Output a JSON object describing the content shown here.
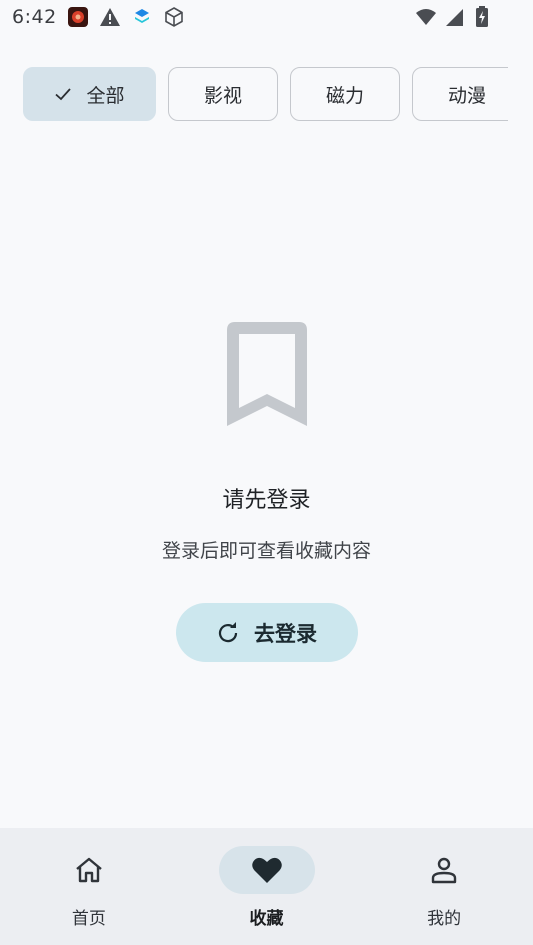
{
  "status_bar": {
    "time": "6:42",
    "left_icons": [
      "app-icon",
      "warning-icon",
      "layers-icon",
      "cube-icon"
    ],
    "right_icons": [
      "wifi-icon",
      "signal-icon",
      "battery-icon"
    ]
  },
  "filters": {
    "chips": [
      {
        "label": "全部",
        "selected": true
      },
      {
        "label": "影视",
        "selected": false
      },
      {
        "label": "磁力",
        "selected": false
      },
      {
        "label": "动漫",
        "selected": false
      }
    ]
  },
  "empty_state": {
    "icon": "bookmark-icon",
    "title": "请先登录",
    "description": "登录后即可查看收藏内容",
    "button_label": "去登录"
  },
  "bottom_nav": {
    "items": [
      {
        "label": "首页",
        "icon": "home-icon",
        "active": false
      },
      {
        "label": "收藏",
        "icon": "heart-icon",
        "active": true
      },
      {
        "label": "我的",
        "icon": "person-icon",
        "active": false
      }
    ]
  },
  "colors": {
    "background": "#f8f9fb",
    "chip_selected": "#d5e2ea",
    "login_button": "#cce7ee",
    "nav_background": "#eceef2",
    "nav_active_pill": "#d7e3ea"
  }
}
